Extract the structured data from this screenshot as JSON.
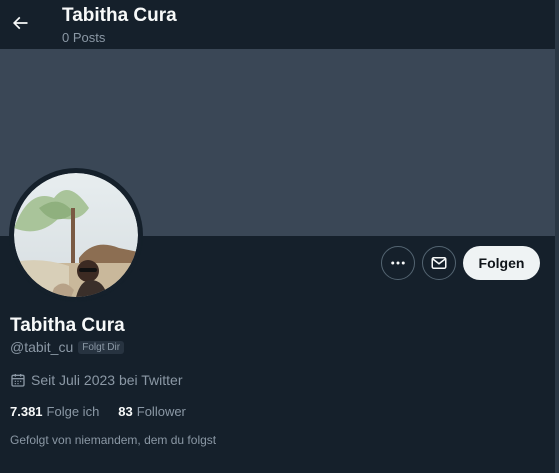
{
  "header": {
    "title": "Tabitha Cura",
    "subtitle": "0 Posts",
    "back_icon": "arrow-left-icon"
  },
  "profile": {
    "display_name": "Tabitha Cura",
    "handle": "@tabit_cu",
    "follows_you_badge": "Folgt Dir",
    "joined": "Seit Juli 2023 bei Twitter",
    "following_count": "7.381",
    "following_label": "Folge ich",
    "followers_count": "83",
    "followers_label": "Follower",
    "followed_by": "Gefolgt von niemandem, dem du folgst"
  },
  "actions": {
    "more_icon": "more-icon",
    "message_icon": "envelope-icon",
    "follow_label": "Folgen"
  },
  "colors": {
    "background": "#15202b",
    "banner": "#3a4756",
    "secondary_text": "#8b98a5",
    "follow_button_bg": "#eff3f4"
  }
}
